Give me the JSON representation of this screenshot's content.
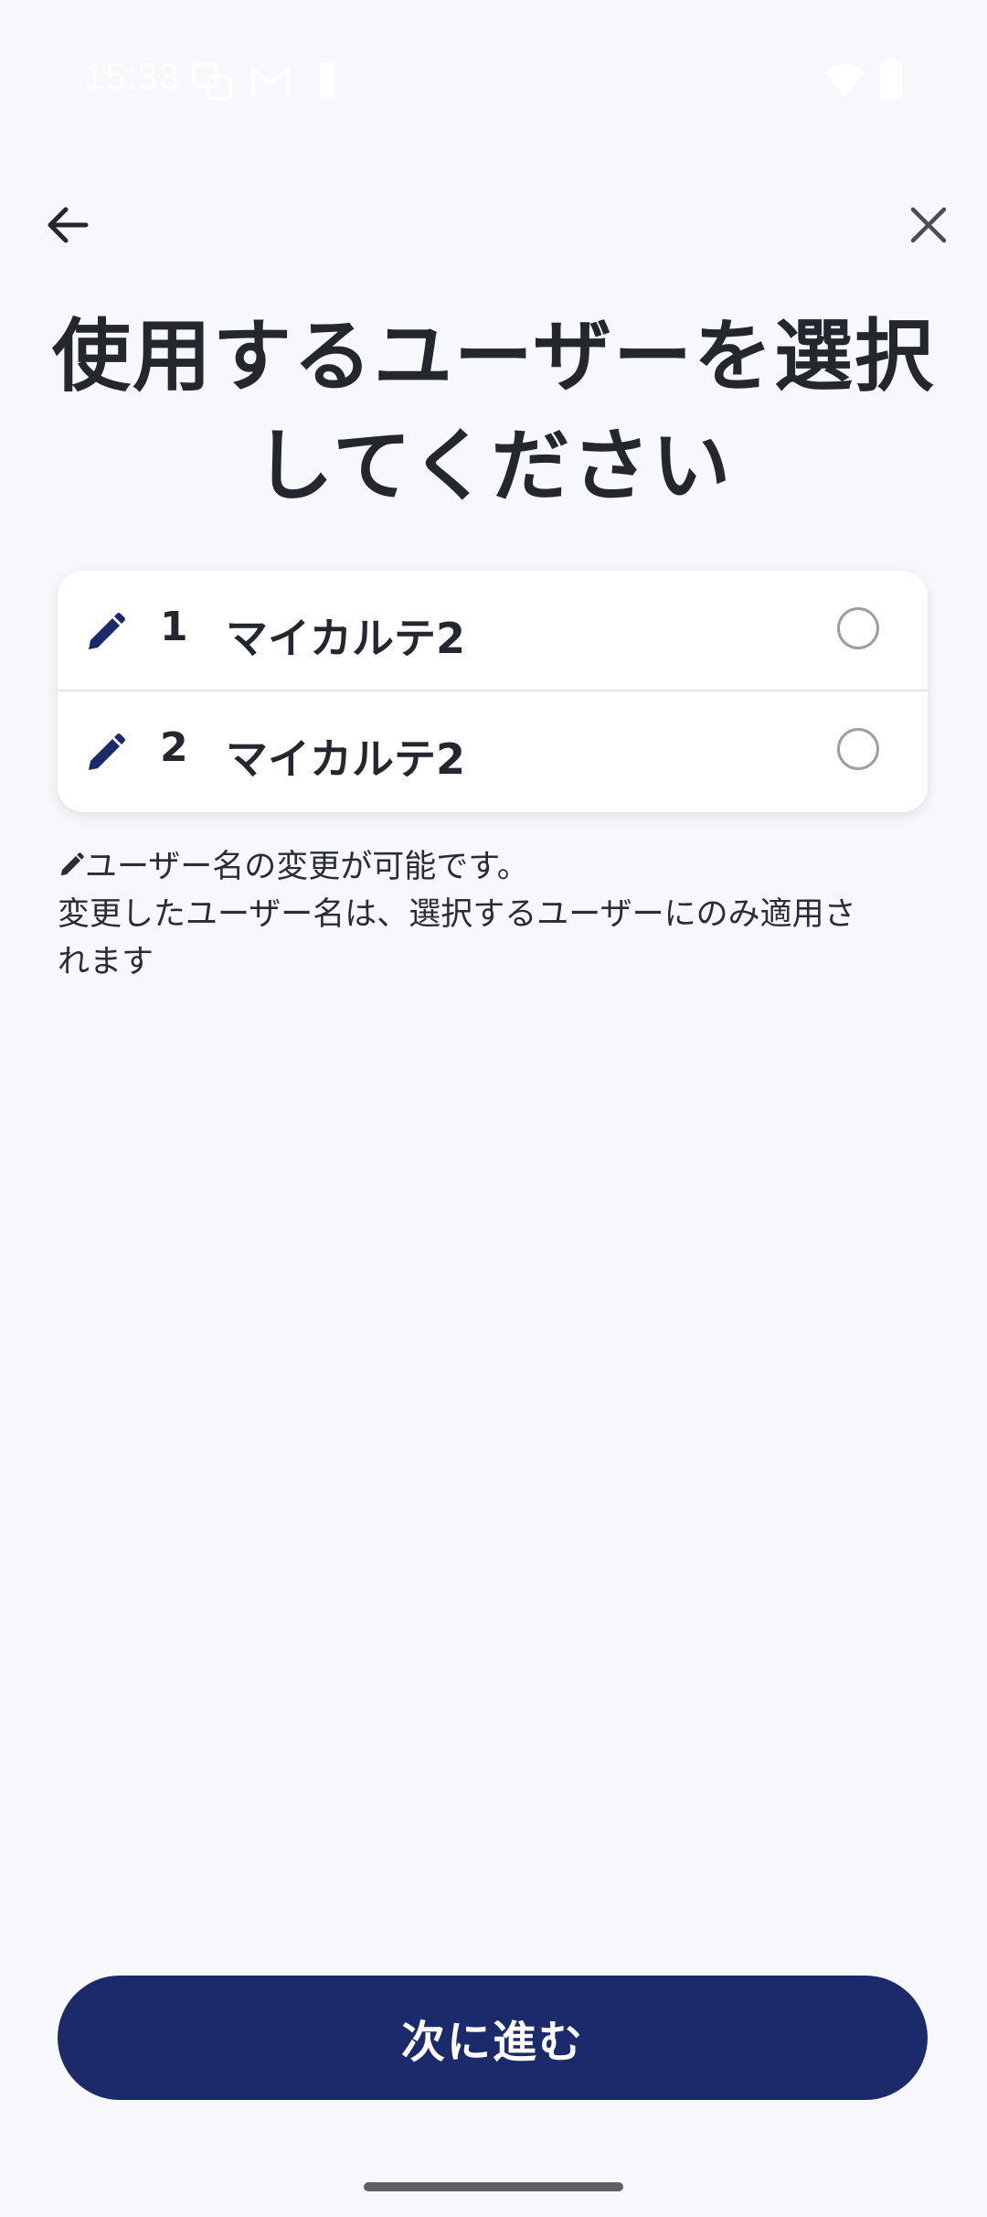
{
  "status_bar": {
    "time": "15:33",
    "icons": [
      "translate-icon",
      "gmail-icon",
      "battery-small-icon",
      "wifi-icon",
      "battery-icon"
    ]
  },
  "topbar": {
    "back_icon": "arrow-left-icon",
    "close_icon": "close-icon"
  },
  "page": {
    "title_line1": "使用するユーザーを選択",
    "title_line2": "してください"
  },
  "users": [
    {
      "number": "1",
      "name": "マイカルテ2",
      "selected": false
    },
    {
      "number": "2",
      "name": "マイカルテ2",
      "selected": false
    }
  ],
  "note": {
    "line1": "ユーザー名の変更が可能です。",
    "line2": "変更したユーザー名は、選択するユーザーにのみ適用さ",
    "line3": "れます"
  },
  "footer": {
    "next_label": "次に進む"
  },
  "colors": {
    "background": "#f7f8fb",
    "primary": "#1b2a6b",
    "text": "#24272e"
  }
}
